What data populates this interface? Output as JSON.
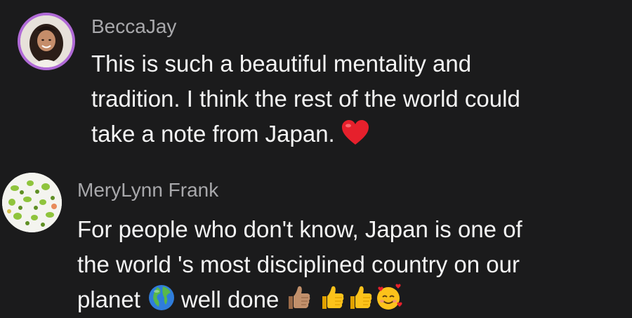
{
  "comments": [
    {
      "username": "BeccaJay",
      "lines": [
        "This is such a beautiful mentality and",
        "tradition. I think the rest of the world could",
        "take a note from Japan."
      ],
      "emojis": [
        "red-heart"
      ]
    },
    {
      "username": "MeryLynn Frank",
      "lines": [
        "For people who don't know, Japan is one of",
        "the world 's most disciplined country on our",
        "planet",
        "well done"
      ],
      "emojis": [
        "globe-africa-europe",
        "thumbs-up-medium-skin",
        "thumbs-up",
        "thumbs-up",
        "smiling-face-with-hearts"
      ]
    }
  ],
  "colors": {
    "background": "#1b1b1c",
    "username": "#a8a8ab",
    "text": "#f4f4f4",
    "avatar_ring": "#b06ad6"
  }
}
